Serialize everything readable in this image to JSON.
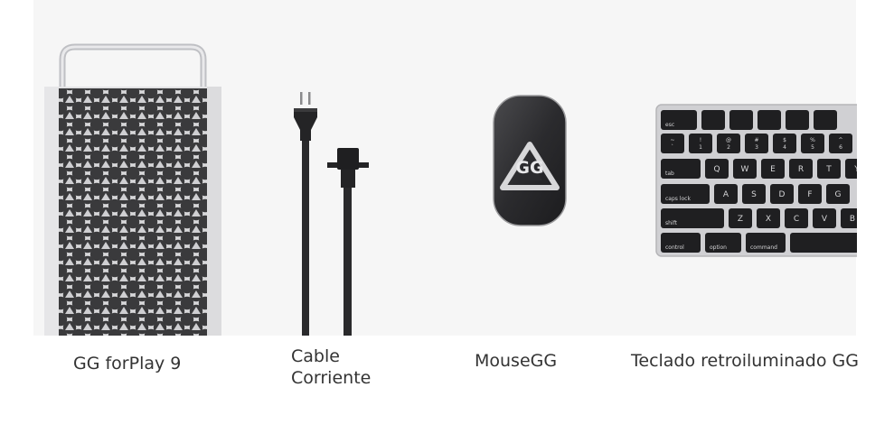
{
  "products": [
    {
      "name": "GG forPlay 9",
      "image": "computer-tower"
    },
    {
      "name_lines": [
        "Cable",
        "Corriente"
      ],
      "image": "power-cable"
    },
    {
      "name": "MouseGG",
      "image": "mouse",
      "logo_text": "GG"
    },
    {
      "name": "Teclado retroiluminado GG",
      "image": "keyboard"
    }
  ],
  "keyboard_keys": {
    "row1": [
      "esc",
      "",
      "",
      "",
      "",
      ""
    ],
    "row2": [
      "~\n`",
      "!\n1",
      "@\n2",
      "#\n3",
      "$\n4",
      "%\n5",
      "^\n6"
    ],
    "row3": [
      "tab",
      "Q",
      "W",
      "E",
      "R",
      "T",
      "Y"
    ],
    "row4": [
      "caps lock",
      "A",
      "S",
      "D",
      "F",
      "G"
    ],
    "row5": [
      "shift",
      "Z",
      "X",
      "C",
      "V",
      "B"
    ],
    "row6": [
      "control",
      "option",
      "command",
      ""
    ]
  },
  "colors": {
    "panel_bg": "#f6f6f6",
    "tower_frame": "#d9d9db",
    "cable": "#2a2a2a",
    "mouse": "#2d2d2f",
    "key": "#1f1f21",
    "keyboard_frame": "#c9c9cc"
  }
}
